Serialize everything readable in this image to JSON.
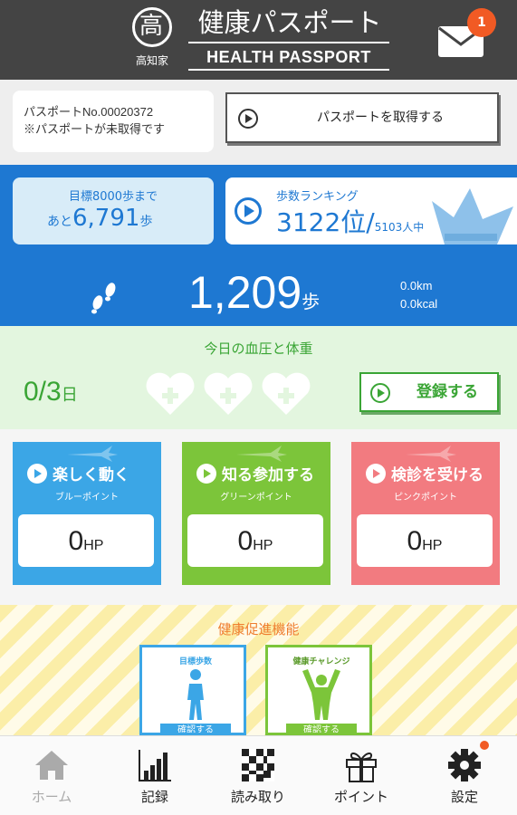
{
  "header": {
    "logo_kanji": "高",
    "logo_sub": "高知家",
    "title_jp": "健康パスポート",
    "title_en": "HEALTH PASSPORT",
    "mail_badge": "1"
  },
  "passport": {
    "number_line": "パスポートNo.00020372",
    "status_line": "※パスポートが未取得です",
    "get_button": "パスポートを取得する"
  },
  "goal": {
    "label": "目標8000歩まで",
    "prefix": "あと",
    "remaining": "6,791",
    "unit": "歩"
  },
  "ranking": {
    "label": "歩数ランキング",
    "rank": "3122位/",
    "total": "5103人中"
  },
  "steps": {
    "value": "1,209",
    "unit": "歩",
    "distance": "0.0km",
    "calories": "0.0kcal"
  },
  "blood_pressure": {
    "title": "今日の血圧と体重",
    "count": "0/3",
    "count_unit": "日",
    "register_button": "登録する"
  },
  "point_cards": [
    {
      "name": "楽しく動く",
      "sub": "ブルーポイント",
      "value": "0",
      "unit": "HP",
      "color": "#3ba6e6"
    },
    {
      "name": "知る参加する",
      "sub": "グリーンポイント",
      "value": "0",
      "unit": "HP",
      "color": "#7cc53a"
    },
    {
      "name": "検診を受ける",
      "sub": "ピンクポイント",
      "value": "0",
      "unit": "HP",
      "color": "#f27b80"
    }
  ],
  "promotion": {
    "title": "健康促進機能",
    "cards": [
      {
        "caption": "目標歩数",
        "button": "確認する"
      },
      {
        "caption": "健康チャレンジ",
        "button": "確認する"
      }
    ]
  },
  "nav": [
    {
      "label": "ホーム",
      "icon": "home-icon",
      "active": true
    },
    {
      "label": "記録",
      "icon": "bar-chart-icon"
    },
    {
      "label": "読み取り",
      "icon": "qr-code-icon"
    },
    {
      "label": "ポイント",
      "icon": "gift-icon"
    },
    {
      "label": "設定",
      "icon": "gear-icon"
    }
  ],
  "colors": {
    "header": "#444444",
    "primary_blue": "#1e78d2",
    "green": "#3aa535",
    "orange": "#f15a24"
  }
}
